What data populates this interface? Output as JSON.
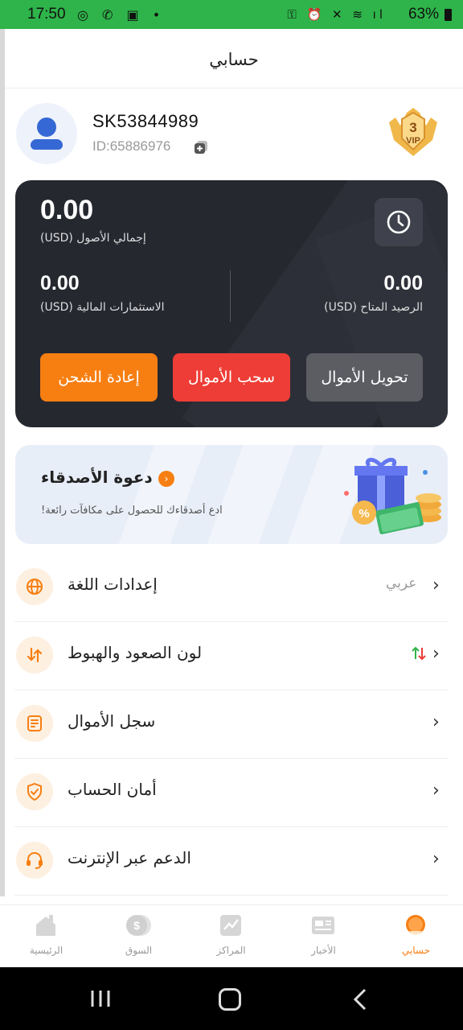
{
  "status_bar": {
    "time": "17:50",
    "battery": "63%"
  },
  "header": {
    "title": "حسابي"
  },
  "profile": {
    "username": "SK53844989",
    "user_id": "ID:65886976",
    "vip_level": "3",
    "vip_text": "VIP"
  },
  "wallet": {
    "total_assets": "0.00",
    "total_assets_label": "(USD)  إجمالي الأصول",
    "investments": "0.00",
    "investments_label": "(USD)  الاستثمارات المالية",
    "available": "0.00",
    "available_label": "(USD)  الرصيد المتاح",
    "recharge_label": "إعادة الشحن",
    "withdraw_label": "سحب الأموال",
    "transfer_label": "تحويل الأموال"
  },
  "invite": {
    "title": "دعوة الأصدقاء",
    "subtitle": "!ادع أصدقاءك للحصول على مكافآت رائعة"
  },
  "menu": {
    "items": [
      {
        "label": "إعدادات اللغة",
        "value": "عربي",
        "icon": "globe-icon"
      },
      {
        "label": "لون الصعود والهبوط",
        "value": "",
        "icon": "updown-arrows-icon"
      },
      {
        "label": "سجل الأموال",
        "value": "",
        "icon": "document-icon"
      },
      {
        "label": "أمان الحساب",
        "value": "",
        "icon": "shield-check-icon"
      },
      {
        "label": "الدعم عبر الإنترنت",
        "value": "",
        "icon": "headset-icon"
      }
    ]
  },
  "bottom_nav": {
    "items": [
      {
        "label": "الرئيسية",
        "icon": "home-icon"
      },
      {
        "label": "السوق",
        "icon": "market-icon"
      },
      {
        "label": "المراكز",
        "icon": "positions-icon"
      },
      {
        "label": "الأخبار",
        "icon": "news-icon"
      },
      {
        "label": "حسابي",
        "icon": "account-icon",
        "active": true
      }
    ]
  },
  "colors": {
    "status_bar": "#2eb44a",
    "accent_orange": "#f77f12",
    "withdraw_red": "#ee3d36",
    "wallet_card": "#262830",
    "avatar_blue": "#3568d4"
  }
}
